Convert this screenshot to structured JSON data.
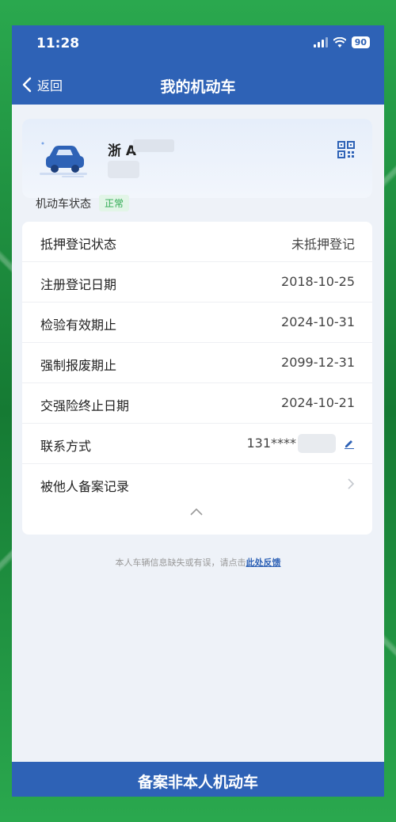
{
  "status_bar": {
    "time": "11:28",
    "battery": "90"
  },
  "navbar": {
    "back_label": "返回",
    "title": "我的机动车"
  },
  "vehicle": {
    "plate": "浙 A"
  },
  "vehicle_status": {
    "label": "机动车状态",
    "badge": "正常"
  },
  "info_rows": [
    {
      "label": "抵押登记状态",
      "value": "未抵押登记"
    },
    {
      "label": "注册登记日期",
      "value": "2018-10-25"
    },
    {
      "label": "检验有效期止",
      "value": "2024-10-31"
    },
    {
      "label": "强制报废期止",
      "value": "2099-12-31"
    },
    {
      "label": "交强险终止日期",
      "value": "2024-10-21"
    },
    {
      "label": "联系方式",
      "value": "131****"
    },
    {
      "label": "被他人备案记录",
      "value": ""
    }
  ],
  "feedback": {
    "text": "本人车辆信息缺失或有误，请点击",
    "link": "此处反馈"
  },
  "bottom_button": {
    "label": "备案非本人机动车"
  },
  "colors": {
    "primary": "#2e62b6",
    "status_green": "#2faa52",
    "background_green": "#1e8a3c"
  },
  "icons": [
    "car-icon",
    "qr-code-icon",
    "edit-icon",
    "chevron-right-icon",
    "chevron-up-icon",
    "back-chevron-icon",
    "signal-icon",
    "wifi-icon",
    "battery-icon"
  ]
}
